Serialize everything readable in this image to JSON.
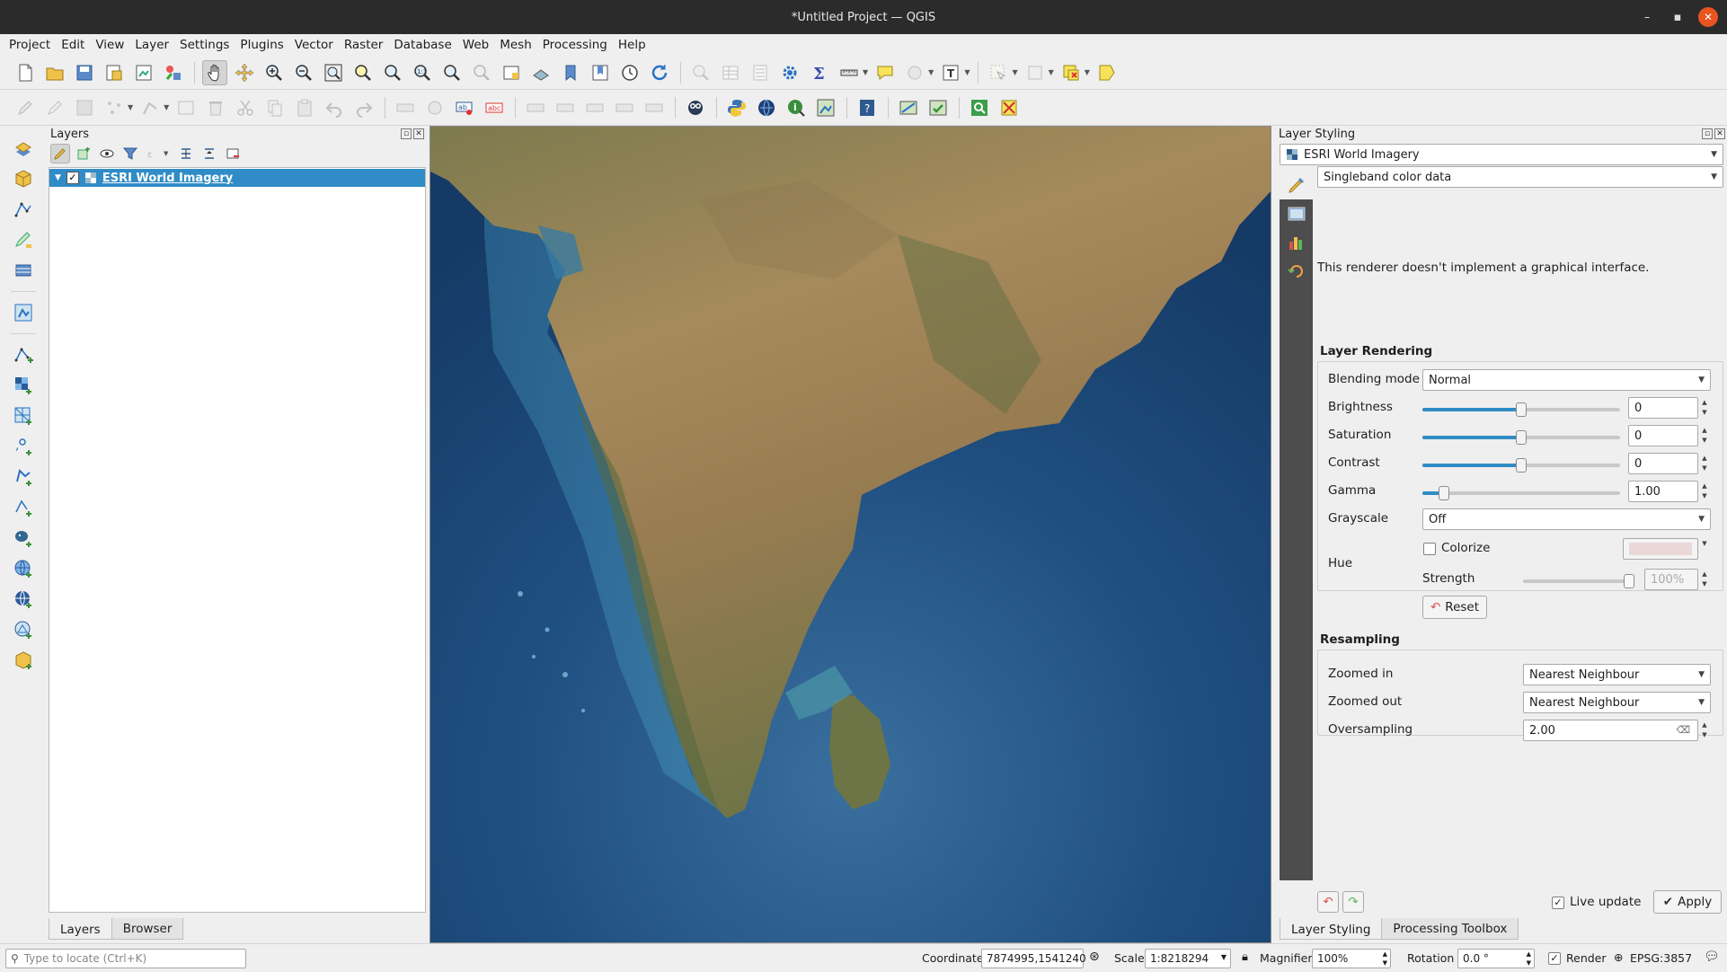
{
  "window": {
    "title": "*Untitled Project — QGIS",
    "controls": {
      "minimize": "–",
      "maximize": "▪",
      "close": "✕"
    }
  },
  "menu": [
    "Project",
    "Edit",
    "View",
    "Layer",
    "Settings",
    "Plugins",
    "Vector",
    "Raster",
    "Database",
    "Web",
    "Mesh",
    "Processing",
    "Help"
  ],
  "layers_panel": {
    "title": "Layers",
    "layer": {
      "name": "ESRI World Imagery",
      "checked": "✓",
      "expand": "▼"
    },
    "tabs": [
      "Layers",
      "Browser"
    ]
  },
  "styling_panel": {
    "title": "Layer Styling",
    "layer_combo": "ESRI World Imagery",
    "renderer_combo": "Singleband color data",
    "renderer_message": "This renderer doesn't implement a graphical interface.",
    "rendering": {
      "title": "Layer Rendering",
      "blending_label": "Blending mode",
      "blending_value": "Normal",
      "brightness_label": "Brightness",
      "brightness_value": "0",
      "saturation_label": "Saturation",
      "saturation_value": "0",
      "contrast_label": "Contrast",
      "contrast_value": "0",
      "gamma_label": "Gamma",
      "gamma_value": "1.00",
      "grayscale_label": "Grayscale",
      "grayscale_value": "Off",
      "hue_label": "Hue",
      "colorize_label": "Colorize",
      "strength_label": "Strength",
      "strength_value": "100%",
      "reset_label": "Reset"
    },
    "resampling": {
      "title": "Resampling",
      "zoomed_in_label": "Zoomed in",
      "zoomed_in_value": "Nearest Neighbour",
      "zoomed_out_label": "Zoomed out",
      "zoomed_out_value": "Nearest Neighbour",
      "oversampling_label": "Oversampling",
      "oversampling_value": "2.00"
    },
    "live_update_label": "Live update",
    "live_update_checked": "✓",
    "apply_label": "Apply",
    "tabs": [
      "Layer Styling",
      "Processing Toolbox"
    ]
  },
  "statusbar": {
    "locate_placeholder": "Type to locate (Ctrl+K)",
    "coordinate_label": "Coordinate",
    "coordinate_value": "7874995,1541240",
    "scale_label": "Scale",
    "scale_value": "1:8218294",
    "magnifier_label": "Magnifier",
    "magnifier_value": "100%",
    "rotation_label": "Rotation",
    "rotation_value": "0.0 °",
    "render_label": "Render",
    "render_checked": "✓",
    "crs": "EPSG:3857"
  },
  "colors": {
    "selection": "#308cc6",
    "ocean": "#1a4a7a",
    "land": "#a88a5c"
  }
}
